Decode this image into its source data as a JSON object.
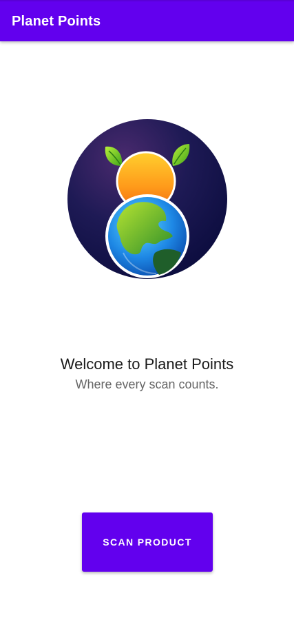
{
  "app_bar": {
    "title": "Planet Points",
    "color": "#6200ee"
  },
  "logo": {
    "icon": "planet-points-logo-icon"
  },
  "welcome": {
    "heading": "Welcome to Planet Points",
    "tagline": "Where every scan counts."
  },
  "actions": {
    "scan_label": "SCAN PRODUCT"
  },
  "colors": {
    "primary": "#6200ee",
    "heading_text": "#1a1a1a",
    "subtext": "#666666"
  }
}
